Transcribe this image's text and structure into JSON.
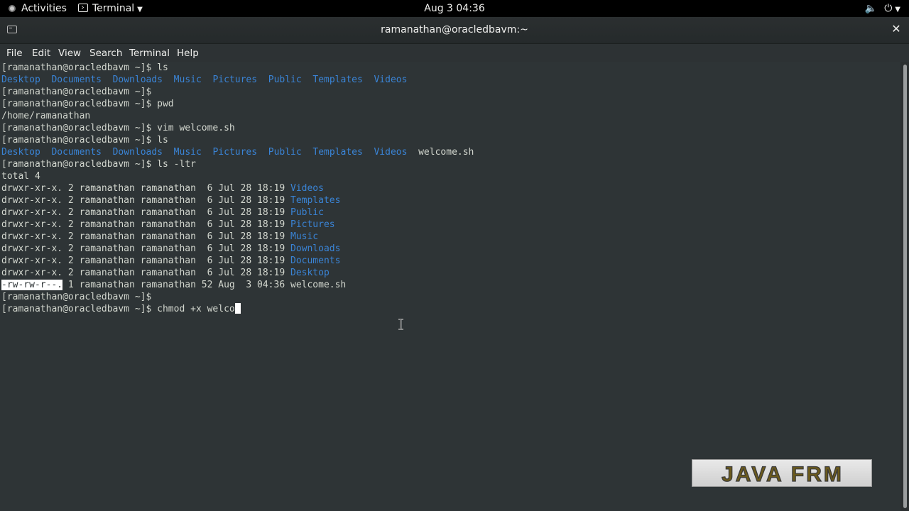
{
  "topbar": {
    "activities_label": "Activities",
    "app_menu_label": "Terminal",
    "clock": "Aug 3  04:36",
    "icons": [
      "volume-icon",
      "power-icon",
      "chevron-down-icon"
    ]
  },
  "window": {
    "title": "ramanathan@oracledbavm:~",
    "close_glyph": "✕"
  },
  "menubar": {
    "items": [
      "File",
      "Edit",
      "View",
      "Search",
      "Terminal",
      "Help"
    ]
  },
  "terminal": {
    "lines": [
      "[ramanathan@oracledbavm ~]$ ls",
      "Desktop  Documents  Downloads  Music  Pictures  Public  Templates  Videos",
      "[ramanathan@oracledbavm ~]$",
      "[ramanathan@oracledbavm ~]$ pwd",
      "/home/ramanathan",
      "[ramanathan@oracledbavm ~]$ vim welcome.sh",
      "[ramanathan@oracledbavm ~]$ ls",
      "Desktop  Documents  Downloads  Music  Pictures  Public  Templates  Videos  welcome.sh",
      "[ramanathan@oracledbavm ~]$ ls -ltr",
      "total 4",
      "drwxr-xr-x. 2 ramanathan ramanathan  6 Jul 28 18:19 Videos",
      "drwxr-xr-x. 2 ramanathan ramanathan  6 Jul 28 18:19 Templates",
      "drwxr-xr-x. 2 ramanathan ramanathan  6 Jul 28 18:19 Public",
      "drwxr-xr-x. 2 ramanathan ramanathan  6 Jul 28 18:19 Pictures",
      "drwxr-xr-x. 2 ramanathan ramanathan  6 Jul 28 18:19 Music",
      "drwxr-xr-x. 2 ramanathan ramanathan  6 Jul 28 18:19 Downloads",
      "drwxr-xr-x. 2 ramanathan ramanathan  6 Jul 28 18:19 Documents",
      "drwxr-xr-x. 2 ramanathan ramanathan  6 Jul 28 18:19 Desktop",
      "-rw-rw-r--. 1 ramanathan ramanathan 52 Aug  3 04:36 welcome.sh",
      "[ramanathan@oracledbavm ~]$",
      "[ramanathan@oracledbavm ~]$ chmod +x welco"
    ],
    "prompt": "[ramanathan@oracledbavm ~]$",
    "ls_dirs": [
      "Desktop",
      "Documents",
      "Downloads",
      "Music",
      "Pictures",
      "Public",
      "Templates",
      "Videos"
    ],
    "ls_file": "welcome.sh",
    "ltr_prefix": "drwxr-xr-x. 2 ramanathan ramanathan  6 Jul 28 18:19 ",
    "file_perms_selected": "-rw-rw-r--.",
    "file_rest": " 1 ramanathan ramanathan 52 Aug  3 04:36 welcome.sh",
    "current_input": "chmod +x welco"
  },
  "watermark": {
    "text": "JAVA FRM"
  },
  "colors": {
    "terminal_bg": "#2e3436",
    "terminal_fg": "#d3d7cf",
    "dir_blue": "#3a84d6",
    "topbar_bg": "#000000"
  }
}
